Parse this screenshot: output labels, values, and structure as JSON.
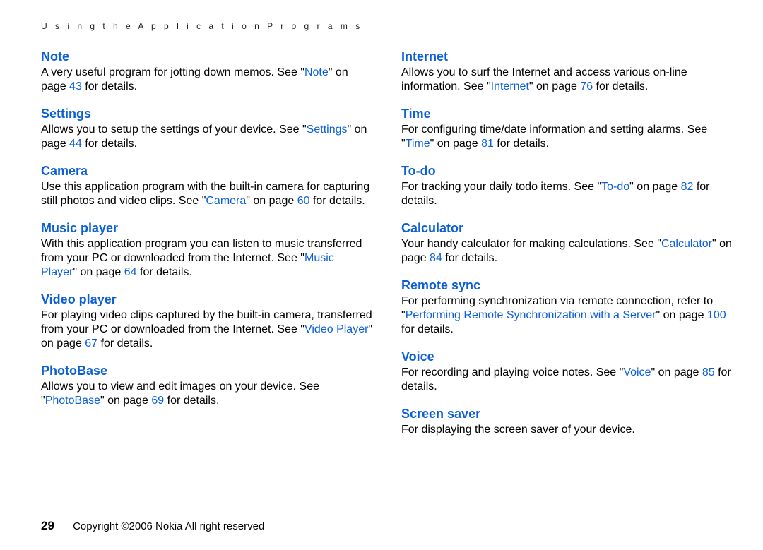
{
  "header": {
    "running_title": "U s i n g   t h e   A p p l i c a t i o n   P r o g r a m s"
  },
  "left": {
    "note": {
      "title": "Note",
      "t1": "A very useful program for jotting down memos. See \"",
      "link1": "Note",
      "t2": "\" on page ",
      "link2": "43",
      "t3": " for details."
    },
    "settings": {
      "title": "Settings",
      "t1": "Allows you to setup the settings of your device. See \"",
      "link1": "Settings",
      "t2": "\" on page ",
      "link2": "44",
      "t3": " for details."
    },
    "camera": {
      "title": "Camera",
      "t1": "Use this application program with the built-in camera for capturing still photos and video clips. See \"",
      "link1": "Camera",
      "t2": "\" on page ",
      "link2": "60",
      "t3": " for details."
    },
    "music": {
      "title": "Music player",
      "t1": "With this application program you can listen to music transferred from your PC or downloaded from the Internet. See \"",
      "link1": "Music Player",
      "t2": "\" on page ",
      "link2": "64",
      "t3": " for details."
    },
    "video": {
      "title": "Video player",
      "t1": "For playing video clips captured by the built-in camera, transferred from your PC or downloaded from the Internet. See \"",
      "link1": "Video Player",
      "t2": "\" on page ",
      "link2": "67",
      "t3": " for details."
    },
    "photobase": {
      "title": "PhotoBase",
      "t1": "Allows you to view and edit images on your device. See \"",
      "link1": "PhotoBase",
      "t2": "\" on page ",
      "link2": "69",
      "t3": " for details."
    }
  },
  "right": {
    "internet": {
      "title": "Internet",
      "t1": "Allows you to surf the Internet and access various on-line information. See \"",
      "link1": "Internet",
      "t2": "\" on page ",
      "link2": "76",
      "t3": " for details."
    },
    "time": {
      "title": "Time",
      "t1": "For configuring time/date information and setting alarms. See \"",
      "link1": "Time",
      "t2": "\" on page ",
      "link2": "81",
      "t3": " for details."
    },
    "todo": {
      "title": "To-do",
      "t1": "For tracking your daily todo items. See \"",
      "link1": "To-do",
      "t2": "\" on page ",
      "link2": "82",
      "t3": " for details."
    },
    "calculator": {
      "title": "Calculator",
      "t1": "Your handy calculator for making calculations. See \"",
      "link1": "Calculator",
      "t2": "\" on page ",
      "link2": "84",
      "t3": " for details."
    },
    "remote": {
      "title": "Remote sync",
      "t1": "For performing synchronization via remote connection, refer to \"",
      "link1": "Performing Remote Synchronization with a Server",
      "t2": "\" on page ",
      "link2": "100",
      "t3": " for details."
    },
    "voice": {
      "title": "Voice",
      "t1": "For recording and playing voice notes. See \"",
      "link1": "Voice",
      "t2": "\" on page ",
      "link2": "85",
      "t3": " for details."
    },
    "screensaver": {
      "title": "Screen saver",
      "t1": "For displaying the screen saver of your device."
    }
  },
  "footer": {
    "page_num": "29",
    "copyright": "Copyright ©2006 Nokia All right reserved"
  }
}
